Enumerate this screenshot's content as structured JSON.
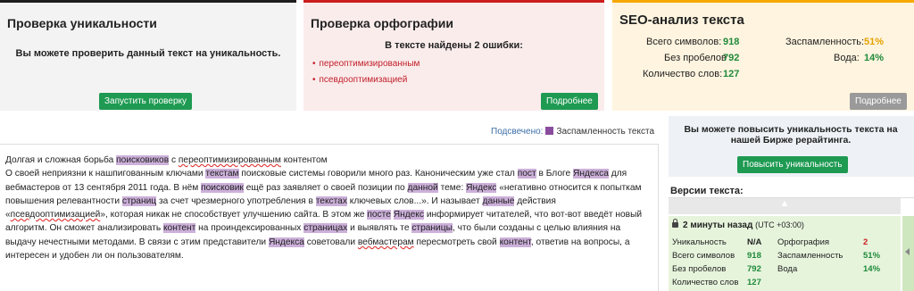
{
  "uniqueness_panel": {
    "title": "Проверка уникальности",
    "text": "Вы можете проверить данный текст на уникальность.",
    "button": "Запустить проверку"
  },
  "spelling_panel": {
    "title": "Проверка орфографии",
    "subtitle": "В тексте найдены 2 ошибки:",
    "errors": [
      "переоптимизированным",
      "псевдооптимизацией"
    ],
    "button": "Подробнее"
  },
  "seo_panel": {
    "title": "SEO-анализ текста",
    "total_chars_label": "Всего символов:",
    "total_chars_value": "918",
    "no_spaces_label": "Без пробелов",
    "no_spaces_value": "792",
    "words_label": "Количество слов:",
    "words_value": "127",
    "spam_label": "Заспамленность:",
    "spam_value": "51%",
    "water_label": "Вода:",
    "water_value": "14%",
    "button": "Подробнее"
  },
  "highlight": {
    "prefix": "Подсвечено:",
    "legend": "Заспамленность текста",
    "color": "#8a4d9e"
  },
  "editor": {
    "segments": [
      {
        "t": "Долгая и сложная борьба "
      },
      {
        "t": "поисковиков",
        "h": 1
      },
      {
        "t": " с "
      },
      {
        "t": "переоптимизированным",
        "s": 1
      },
      {
        "t": " контентом"
      },
      {
        "br": 1
      },
      {
        "t": "О своей неприязни к нашпигованным ключами "
      },
      {
        "t": "текстам",
        "h": 1
      },
      {
        "t": " поисковые системы говорили много раз. Каноническим уже стал "
      },
      {
        "t": "пост",
        "h": 1
      },
      {
        "t": " в Блоге "
      },
      {
        "t": "Яндекса",
        "h": 1
      },
      {
        "t": " для вебмастеров от 13 сентября 2011 года. В нём "
      },
      {
        "t": "поисковик",
        "h": 1
      },
      {
        "t": " ещё раз заявляет о своей позиции по "
      },
      {
        "t": "данной",
        "h": 1
      },
      {
        "t": " теме: "
      },
      {
        "t": "Яндекс",
        "h": 1
      },
      {
        "t": " «негативно относится к попыткам повышения релевантности "
      },
      {
        "t": "страниц",
        "h": 1
      },
      {
        "t": " за счет чрезмерного употребления в "
      },
      {
        "t": "текстах",
        "h": 1
      },
      {
        "t": " ключевых слов...». И называет "
      },
      {
        "t": "данные",
        "h": 1
      },
      {
        "t": " действия «"
      },
      {
        "t": "псевдооптимизацией",
        "s": 1
      },
      {
        "t": "», которая никак не способствует улучшению сайта. В этом же "
      },
      {
        "t": "посте",
        "h": 1
      },
      {
        "t": " "
      },
      {
        "t": "Яндекс",
        "h": 1
      },
      {
        "t": " информирует читателей, что вот-вот введёт новый алгоритм. Он сможет анализировать "
      },
      {
        "t": "контент",
        "h": 1
      },
      {
        "t": " на проиндексированных "
      },
      {
        "t": "страницах",
        "h": 1
      },
      {
        "t": " и выявлять те "
      },
      {
        "t": "страницы",
        "h": 1
      },
      {
        "t": ", что были созданы с целью влияния на выдачу нечестными методами. В связи с этим представители "
      },
      {
        "t": "Яндекса",
        "h": 1
      },
      {
        "t": " советовали "
      },
      {
        "t": "вебмастерам",
        "s": 1
      },
      {
        "t": " пересмотреть свой "
      },
      {
        "t": "контент",
        "h": 1
      },
      {
        "t": ", ответив на вопросы, а интересен и удобен ли он пользователям."
      }
    ]
  },
  "promo": {
    "text": "Вы можете повысить уникальность текста на нашей Бирже рерайтинга.",
    "button": "Повысить уникальность"
  },
  "versions": {
    "title": "Версии текста:",
    "item": {
      "time": "2 минуты назад",
      "tz": "(UTC +03:00)",
      "uniq_label": "Уникальность",
      "uniq_value": "N/A",
      "spell_label": "Орфография",
      "spell_value": "2",
      "total_label": "Всего символов",
      "total_value": "918",
      "spam_label": "Заспамленность",
      "spam_value": "51%",
      "nospace_label": "Без пробелов",
      "nospace_value": "792",
      "water_label": "Вода",
      "water_value": "14%",
      "words_label": "Количество слов",
      "words_value": "127"
    }
  }
}
